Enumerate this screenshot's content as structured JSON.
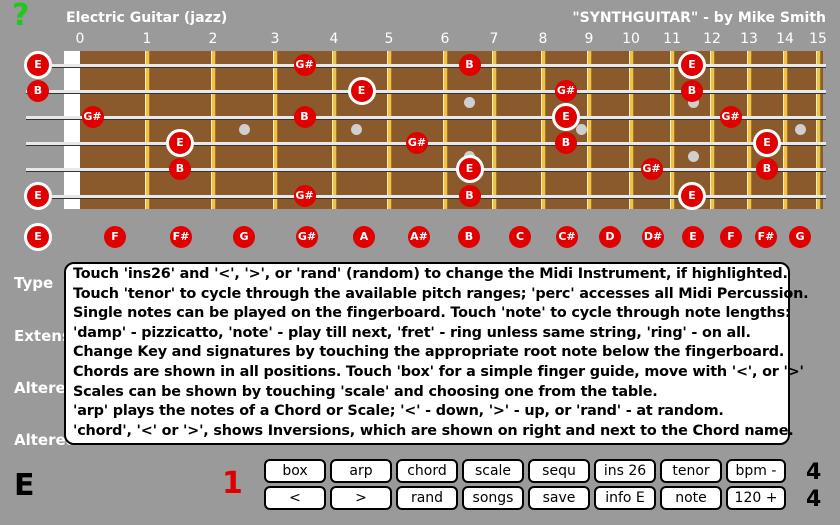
{
  "header": {
    "help": "?",
    "instrument": "Electric Guitar (jazz)",
    "credit": "\"SYNTHGUITAR\" - by Mike Smith"
  },
  "fret_numbers": [
    "0",
    "1",
    "2",
    "3",
    "4",
    "5",
    "6",
    "7",
    "8",
    "9",
    "10",
    "11",
    "12",
    "13",
    "14",
    "15"
  ],
  "fretboard": {
    "strings": [
      {
        "name": "string-1",
        "notes": [
          {
            "fret": 0,
            "note": "E",
            "root": true
          },
          {
            "fret": 4,
            "note": "G#"
          },
          {
            "fret": 7,
            "note": "B"
          },
          {
            "fret": 12,
            "note": "E",
            "root": true
          }
        ]
      },
      {
        "name": "string-2",
        "notes": [
          {
            "fret": 0,
            "note": "B"
          },
          {
            "fret": 5,
            "note": "E",
            "root": true
          },
          {
            "fret": 9,
            "note": "G#"
          },
          {
            "fret": 12,
            "note": "B"
          }
        ]
      },
      {
        "name": "string-3",
        "notes": [
          {
            "fret": 1,
            "note": "G#"
          },
          {
            "fret": 4,
            "note": "B"
          },
          {
            "fret": 9,
            "note": "E",
            "root": true
          },
          {
            "fret": 13,
            "note": "G#"
          }
        ]
      },
      {
        "name": "string-4",
        "notes": [
          {
            "fret": 2,
            "note": "E",
            "root": true
          },
          {
            "fret": 6,
            "note": "G#"
          },
          {
            "fret": 9,
            "note": "B"
          },
          {
            "fret": 14,
            "note": "E",
            "root": true
          }
        ]
      },
      {
        "name": "string-5",
        "notes": [
          {
            "fret": 2,
            "note": "B"
          },
          {
            "fret": 7,
            "note": "E",
            "root": true
          },
          {
            "fret": 11,
            "note": "G#"
          },
          {
            "fret": 14,
            "note": "B"
          }
        ]
      },
      {
        "name": "string-6",
        "notes": [
          {
            "fret": 0,
            "note": "E",
            "root": true
          },
          {
            "fret": 4,
            "note": "G#"
          },
          {
            "fret": 7,
            "note": "B"
          },
          {
            "fret": 12,
            "note": "E",
            "root": true
          }
        ]
      }
    ]
  },
  "key_notes": [
    "E",
    "F",
    "F#",
    "G",
    "G#",
    "A",
    "A#",
    "B",
    "C",
    "C#",
    "D",
    "D#",
    "E",
    "F",
    "F#",
    "G"
  ],
  "side_labels": [
    "Type",
    "Extens",
    "Altered",
    "Altered"
  ],
  "info_lines": [
    "Touch 'ins26' and '<', '>', or 'rand' (random) to change the Midi Instrument, if highlighted.",
    "Touch 'tenor' to cycle through the available pitch ranges; 'perc' accesses all Midi Percussion.",
    "Single notes can be played on the fingerboard. Touch 'note' to cycle through note lengths:",
    "'damp' - pizzicatto, 'note' - play till next, 'fret' - ring unless same string, 'ring' - on all.",
    "Change Key and signatures by touching the appropriate root note below the fingerboard.",
    "Chords are shown in all positions. Touch 'box' for a simple finger guide, move with '<', or '>'",
    "Scales can be shown by touching 'scale' and choosing one from the table.",
    "'arp' plays the notes of a Chord or Scale; '<' - down, '>' - up, or 'rand' - at random.",
    "'chord', '<' or '>', shows Inversions, which are shown on right and next to the Chord name."
  ],
  "bottom": {
    "key": "E",
    "number": "1",
    "beat_top": "4",
    "beat_bottom": "4"
  },
  "buttons_row1": [
    "box",
    "arp",
    "chord",
    "scale",
    "sequ",
    "ins 26",
    "tenor",
    "bpm -"
  ],
  "buttons_row2": [
    "<",
    ">",
    "rand",
    "songs",
    "save",
    "info E",
    "note",
    "120 +"
  ]
}
